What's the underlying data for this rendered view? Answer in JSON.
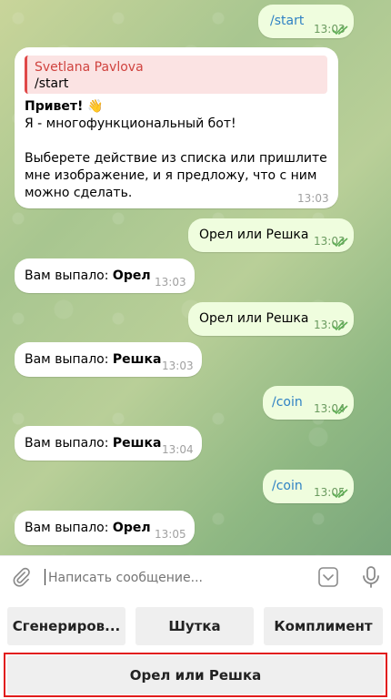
{
  "messages": [
    {
      "dir": "out",
      "text": "/start",
      "time": "13:03"
    },
    {
      "dir": "in",
      "reply_name": "Svetlana Pavlova",
      "reply_text": "/start",
      "greeting": "Привет! 👋",
      "line2": "Я - многофункциональный бот!",
      "line3": "Выберете действие из списка или пришлите",
      "line4": "мне изображение, и я предложу, что с ним",
      "line5": "можно сделать.",
      "time": "13:03"
    },
    {
      "dir": "out",
      "text": "Орел или Решка",
      "time": "13:03"
    },
    {
      "dir": "in",
      "prefix": "Вам выпало: ",
      "result": "Орел",
      "time": "13:03"
    },
    {
      "dir": "out",
      "text": "Орел или Решка",
      "time": "13:03"
    },
    {
      "dir": "in",
      "prefix": "Вам выпало: ",
      "result": "Решка",
      "time": "13:03"
    },
    {
      "dir": "out",
      "text": "/coin",
      "time": "13:04"
    },
    {
      "dir": "in",
      "prefix": "Вам выпало: ",
      "result": "Решка",
      "time": "13:04"
    },
    {
      "dir": "out",
      "text": "/coin",
      "time": "13:05"
    },
    {
      "dir": "in",
      "prefix": "Вам выпало: ",
      "result": "Орел",
      "time": "13:05"
    }
  ],
  "input": {
    "placeholder": "Написать сообщение..."
  },
  "keyboard": {
    "row1": [
      "Сгенериров...",
      "Шутка",
      "Комплимент"
    ],
    "row2": [
      "Орел или Решка"
    ]
  },
  "colors": {
    "highlight": "#e11b1b",
    "outgoing": "#effdde",
    "check": "#6a9a5f",
    "command": "#2f82c4"
  }
}
